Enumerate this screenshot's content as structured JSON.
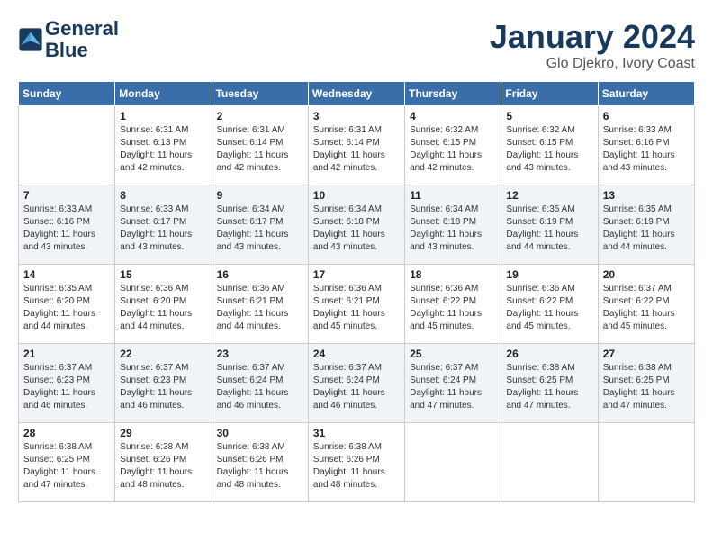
{
  "header": {
    "logo_line1": "General",
    "logo_line2": "Blue",
    "month_title": "January 2024",
    "subtitle": "Glo Djekro, Ivory Coast"
  },
  "days_of_week": [
    "Sunday",
    "Monday",
    "Tuesday",
    "Wednesday",
    "Thursday",
    "Friday",
    "Saturday"
  ],
  "weeks": [
    [
      {
        "day": "",
        "info": ""
      },
      {
        "day": "1",
        "info": "Sunrise: 6:31 AM\nSunset: 6:13 PM\nDaylight: 11 hours\nand 42 minutes."
      },
      {
        "day": "2",
        "info": "Sunrise: 6:31 AM\nSunset: 6:14 PM\nDaylight: 11 hours\nand 42 minutes."
      },
      {
        "day": "3",
        "info": "Sunrise: 6:31 AM\nSunset: 6:14 PM\nDaylight: 11 hours\nand 42 minutes."
      },
      {
        "day": "4",
        "info": "Sunrise: 6:32 AM\nSunset: 6:15 PM\nDaylight: 11 hours\nand 42 minutes."
      },
      {
        "day": "5",
        "info": "Sunrise: 6:32 AM\nSunset: 6:15 PM\nDaylight: 11 hours\nand 43 minutes."
      },
      {
        "day": "6",
        "info": "Sunrise: 6:33 AM\nSunset: 6:16 PM\nDaylight: 11 hours\nand 43 minutes."
      }
    ],
    [
      {
        "day": "7",
        "info": "Sunrise: 6:33 AM\nSunset: 6:16 PM\nDaylight: 11 hours\nand 43 minutes."
      },
      {
        "day": "8",
        "info": "Sunrise: 6:33 AM\nSunset: 6:17 PM\nDaylight: 11 hours\nand 43 minutes."
      },
      {
        "day": "9",
        "info": "Sunrise: 6:34 AM\nSunset: 6:17 PM\nDaylight: 11 hours\nand 43 minutes."
      },
      {
        "day": "10",
        "info": "Sunrise: 6:34 AM\nSunset: 6:18 PM\nDaylight: 11 hours\nand 43 minutes."
      },
      {
        "day": "11",
        "info": "Sunrise: 6:34 AM\nSunset: 6:18 PM\nDaylight: 11 hours\nand 43 minutes."
      },
      {
        "day": "12",
        "info": "Sunrise: 6:35 AM\nSunset: 6:19 PM\nDaylight: 11 hours\nand 44 minutes."
      },
      {
        "day": "13",
        "info": "Sunrise: 6:35 AM\nSunset: 6:19 PM\nDaylight: 11 hours\nand 44 minutes."
      }
    ],
    [
      {
        "day": "14",
        "info": "Sunrise: 6:35 AM\nSunset: 6:20 PM\nDaylight: 11 hours\nand 44 minutes."
      },
      {
        "day": "15",
        "info": "Sunrise: 6:36 AM\nSunset: 6:20 PM\nDaylight: 11 hours\nand 44 minutes."
      },
      {
        "day": "16",
        "info": "Sunrise: 6:36 AM\nSunset: 6:21 PM\nDaylight: 11 hours\nand 44 minutes."
      },
      {
        "day": "17",
        "info": "Sunrise: 6:36 AM\nSunset: 6:21 PM\nDaylight: 11 hours\nand 45 minutes."
      },
      {
        "day": "18",
        "info": "Sunrise: 6:36 AM\nSunset: 6:22 PM\nDaylight: 11 hours\nand 45 minutes."
      },
      {
        "day": "19",
        "info": "Sunrise: 6:36 AM\nSunset: 6:22 PM\nDaylight: 11 hours\nand 45 minutes."
      },
      {
        "day": "20",
        "info": "Sunrise: 6:37 AM\nSunset: 6:22 PM\nDaylight: 11 hours\nand 45 minutes."
      }
    ],
    [
      {
        "day": "21",
        "info": "Sunrise: 6:37 AM\nSunset: 6:23 PM\nDaylight: 11 hours\nand 46 minutes."
      },
      {
        "day": "22",
        "info": "Sunrise: 6:37 AM\nSunset: 6:23 PM\nDaylight: 11 hours\nand 46 minutes."
      },
      {
        "day": "23",
        "info": "Sunrise: 6:37 AM\nSunset: 6:24 PM\nDaylight: 11 hours\nand 46 minutes."
      },
      {
        "day": "24",
        "info": "Sunrise: 6:37 AM\nSunset: 6:24 PM\nDaylight: 11 hours\nand 46 minutes."
      },
      {
        "day": "25",
        "info": "Sunrise: 6:37 AM\nSunset: 6:24 PM\nDaylight: 11 hours\nand 47 minutes."
      },
      {
        "day": "26",
        "info": "Sunrise: 6:38 AM\nSunset: 6:25 PM\nDaylight: 11 hours\nand 47 minutes."
      },
      {
        "day": "27",
        "info": "Sunrise: 6:38 AM\nSunset: 6:25 PM\nDaylight: 11 hours\nand 47 minutes."
      }
    ],
    [
      {
        "day": "28",
        "info": "Sunrise: 6:38 AM\nSunset: 6:25 PM\nDaylight: 11 hours\nand 47 minutes."
      },
      {
        "day": "29",
        "info": "Sunrise: 6:38 AM\nSunset: 6:26 PM\nDaylight: 11 hours\nand 48 minutes."
      },
      {
        "day": "30",
        "info": "Sunrise: 6:38 AM\nSunset: 6:26 PM\nDaylight: 11 hours\nand 48 minutes."
      },
      {
        "day": "31",
        "info": "Sunrise: 6:38 AM\nSunset: 6:26 PM\nDaylight: 11 hours\nand 48 minutes."
      },
      {
        "day": "",
        "info": ""
      },
      {
        "day": "",
        "info": ""
      },
      {
        "day": "",
        "info": ""
      }
    ]
  ]
}
